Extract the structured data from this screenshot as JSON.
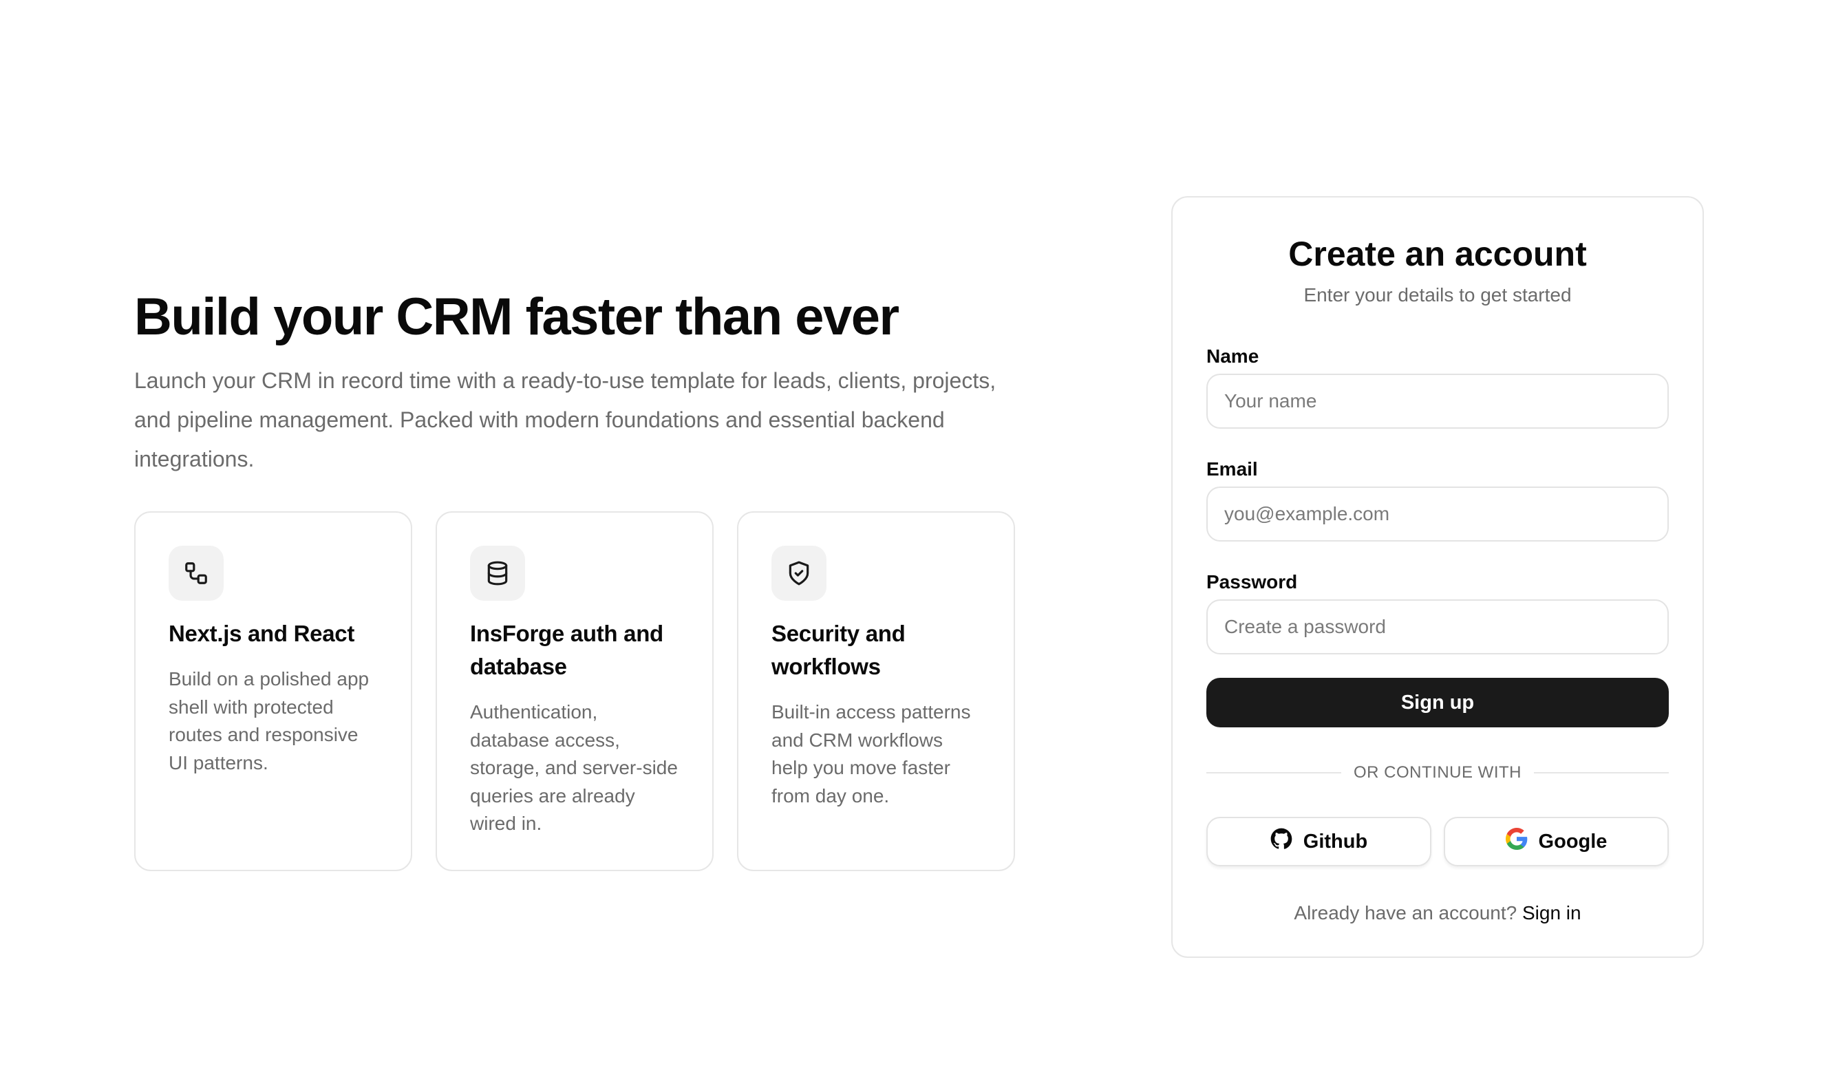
{
  "hero": {
    "title": "Build your CRM faster than ever",
    "description": "Launch your CRM in record time with a ready-to-use template for leads, clients, projects, and pipeline management. Packed with modern foundations and essential backend integrations."
  },
  "features": [
    {
      "icon": "workflow-icon",
      "title": "Next.js and React",
      "description": "Build on a polished app shell with protected routes and responsive UI patterns."
    },
    {
      "icon": "database-icon",
      "title": "InsForge auth and database",
      "description": "Authentication, database access, storage, and server-side queries are already wired in."
    },
    {
      "icon": "shield-check-icon",
      "title": "Security and workflows",
      "description": "Built-in access patterns and CRM workflows help you move faster from day one."
    }
  ],
  "auth": {
    "title": "Create an account",
    "subtitle": "Enter your details to get started",
    "name_label": "Name",
    "name_placeholder": "Your name",
    "email_label": "Email",
    "email_placeholder": "you@example.com",
    "password_label": "Password",
    "password_placeholder": "Create a password",
    "submit_label": "Sign up",
    "divider_text": "OR CONTINUE WITH",
    "github_label": "Github",
    "google_label": "Google",
    "signin_prompt": "Already have an account?",
    "signin_link": "Sign in"
  },
  "colors": {
    "primary_button": "#1a1a1a",
    "muted_text": "#6b6b6b",
    "border": "#e6e6e6"
  }
}
